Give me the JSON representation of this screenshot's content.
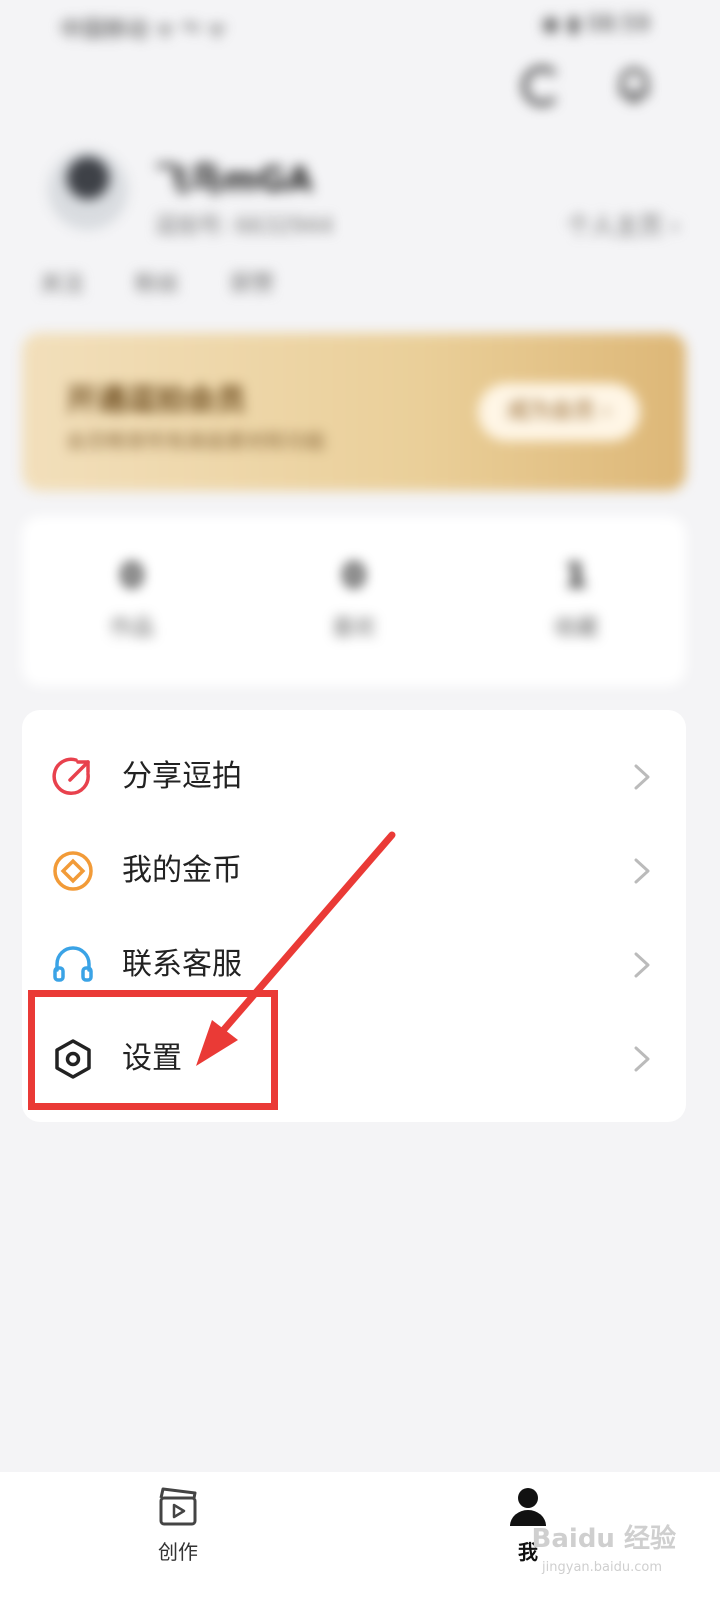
{
  "status_bar": {
    "left_text": "中国移动 ᯤ ⁴ᵍ ᯤ",
    "right_text": "◉ ▮ 08:59"
  },
  "header_icons": [
    "refresh-icon",
    "bell-icon"
  ],
  "profile": {
    "username": "飞鸟mGA",
    "user_id": "逗拍号: 6632944",
    "homepage_link": "个人主页 ›",
    "tags": [
      "关注",
      "粉丝",
      "获赞"
    ]
  },
  "vip_banner": {
    "title": "开通逗拍会员",
    "subtitle": "会员畅享所有高级素材和功能",
    "button": "成为会员 ›"
  },
  "stats": [
    {
      "value": "0",
      "label": "作品"
    },
    {
      "value": "0",
      "label": "喜欢"
    },
    {
      "value": "1",
      "label": "收藏"
    }
  ],
  "menu": [
    {
      "label": "分享逗拍",
      "icon": "share-icon"
    },
    {
      "label": "我的金币",
      "icon": "coin-icon"
    },
    {
      "label": "联系客服",
      "icon": "headset-icon"
    },
    {
      "label": "设置",
      "icon": "settings-icon"
    }
  ],
  "bottom_nav": [
    {
      "label": "创作",
      "icon": "clapperboard-icon"
    },
    {
      "label": "我",
      "icon": "person-icon"
    }
  ],
  "watermark": {
    "main": "Baidu 经验",
    "sub": "jingyan.baidu.com"
  },
  "colors": {
    "accent_red": "#e8414d",
    "coin_orange": "#f29b38",
    "headset_blue": "#3aa3e6",
    "annotation_red": "#ea3a36"
  }
}
